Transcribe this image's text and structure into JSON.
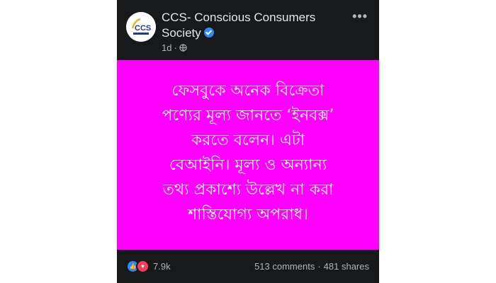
{
  "post": {
    "page_name": "CCS- Conscious Consumers Society",
    "avatar_text": "CCS",
    "time": "1d",
    "separator": "·",
    "more_icon": "•••",
    "background_color": "#ff00ff",
    "text_lines": [
      "ফেসবুকে অনেক বিক্রেতা",
      "পণ্যের মূল্য জানতে ‘ইনবক্স’",
      "করতে বলেন। এটা",
      "বেআইনি। মূল্য ও অন্যান্য",
      "তথ্য প্রকাশ্যে উল্লেখ না করা",
      "শাস্তিযোগ্য অপরাধ।"
    ],
    "reactions": {
      "count": "7.9k",
      "types": [
        "like-icon",
        "love-icon"
      ]
    },
    "comments": "513 comments",
    "dot": "·",
    "shares": "481 shares"
  },
  "colors": {
    "accent": "#2d88ff",
    "love": "#f33e58",
    "card": "#18191a"
  }
}
